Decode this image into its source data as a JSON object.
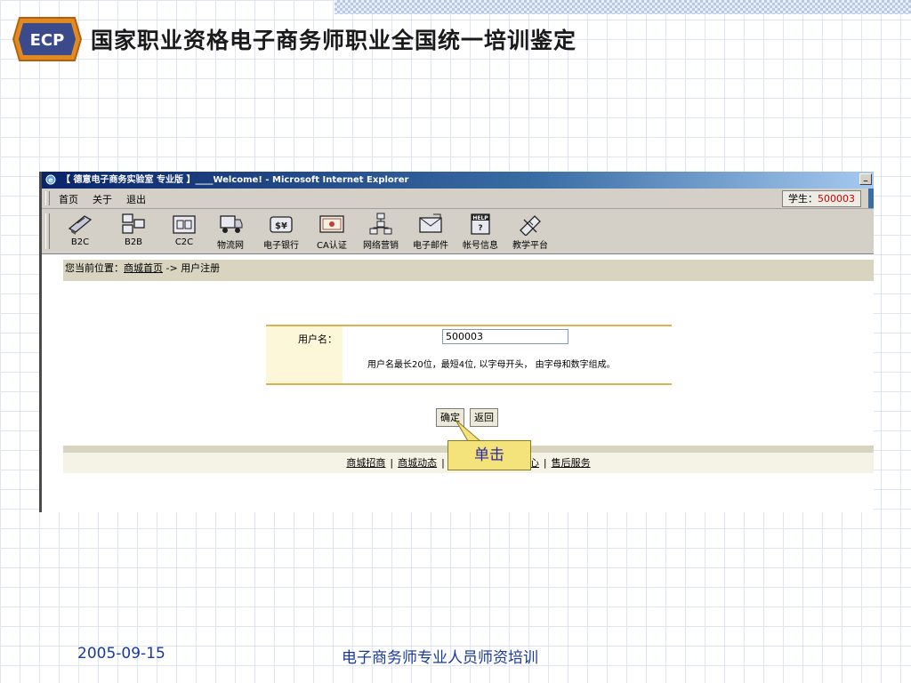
{
  "slide": {
    "title": "国家职业资格电子商务师职业全国统一培训鉴定",
    "logo_text": "ECP",
    "date": "2005-09-15",
    "caption": "电子商务师专业人员师资培训"
  },
  "window": {
    "title": "【 德意电子商务实验室 专业版 】____Welcome! - Microsoft Internet Explorer"
  },
  "menubar": {
    "items": [
      "首页",
      "关于",
      "退出"
    ],
    "student_label": "学生：",
    "student_id": "500003"
  },
  "toolbar": {
    "items": [
      {
        "label": "B2C",
        "icon": "b2c-icon"
      },
      {
        "label": "B2B",
        "icon": "b2b-icon"
      },
      {
        "label": "C2C",
        "icon": "c2c-icon"
      },
      {
        "label": "物流网",
        "icon": "logistics-truck-icon"
      },
      {
        "label": "电子银行",
        "icon": "ebank-icon"
      },
      {
        "label": "CA认证",
        "icon": "ca-certificate-icon"
      },
      {
        "label": "网络营销",
        "icon": "network-marketing-icon"
      },
      {
        "label": "电子邮件",
        "icon": "email-icon"
      },
      {
        "label": "帐号信息",
        "icon": "help-account-icon"
      },
      {
        "label": "教学平台",
        "icon": "teaching-platform-icon"
      }
    ]
  },
  "breadcrumb": {
    "prefix": "您当前位置：",
    "home": "商城首页",
    "arrow": " -> ",
    "current": "用户注册"
  },
  "form": {
    "username_label": "用户名：",
    "username_value": "500003",
    "hint": "用户名最长20位，最短4位, 以字母开头， 由字母和数字组成。",
    "confirm_label": "确定",
    "back_label": "返回"
  },
  "footer_links": [
    "商城招商",
    "商城动态",
    "",
    "心",
    "售后服务"
  ],
  "callout": {
    "text": "单击"
  },
  "colors": {
    "accent_border": "#e0b050",
    "label_bg": "#fbf7d8",
    "callout_bg": "#f4e27a",
    "student_id": "#cc0000"
  }
}
